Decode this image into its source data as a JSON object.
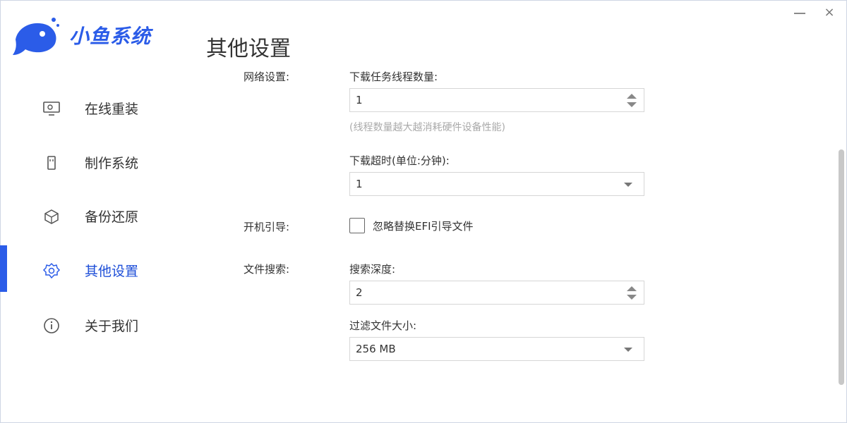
{
  "window": {
    "minimize_label": "",
    "close_label": "×"
  },
  "brand": {
    "name": "小鱼系统",
    "color": "#2b5ce8"
  },
  "page_title": "其他设置",
  "sidebar": {
    "items": [
      {
        "label": "在线重装",
        "icon": "monitor-icon",
        "active": false
      },
      {
        "label": "制作系统",
        "icon": "usb-icon",
        "active": false
      },
      {
        "label": "备份还原",
        "icon": "cube-icon",
        "active": false
      },
      {
        "label": "其他设置",
        "icon": "gear-icon",
        "active": true
      },
      {
        "label": "关于我们",
        "icon": "info-icon",
        "active": false
      }
    ]
  },
  "settings": {
    "network": {
      "section_label": "网络设置:",
      "threads_label": "下载任务线程数量:",
      "threads_value": "1",
      "threads_hint": "(线程数量越大越消耗硬件设备性能)",
      "timeout_label": "下载超时(单位:分钟):",
      "timeout_value": "1"
    },
    "boot": {
      "section_label": "开机引导:",
      "ignore_efi_label": "忽略替换EFI引导文件",
      "ignore_efi_checked": false
    },
    "file_search": {
      "section_label": "文件搜索:",
      "depth_label": "搜索深度:",
      "depth_value": "2",
      "filter_label": "过滤文件大小:",
      "filter_value": "256 MB"
    }
  },
  "colors": {
    "accent": "#2b5ce8",
    "hint": "#aaaaaa",
    "border": "#d6d6d6"
  }
}
